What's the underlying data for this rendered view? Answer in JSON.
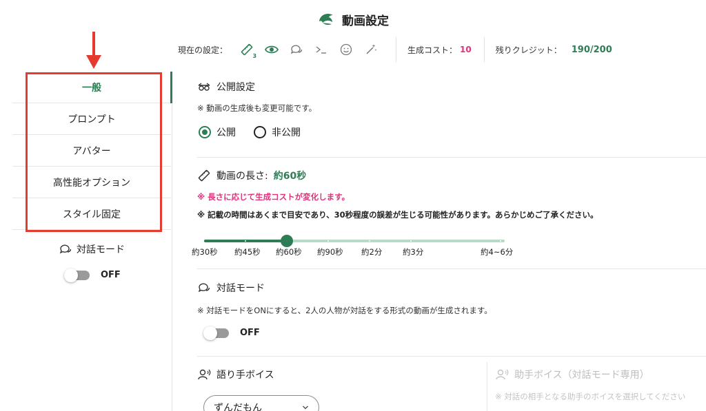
{
  "header": {
    "title": "動画設定",
    "current_label": "現在の設定：",
    "length_badge": "3",
    "cost_label": "生成コスト：",
    "cost_value": "10",
    "credit_label": "残りクレジット：",
    "credit_value": "190/200"
  },
  "sidebar": {
    "items": [
      {
        "label": "一般"
      },
      {
        "label": "プロンプト"
      },
      {
        "label": "アバター"
      },
      {
        "label": "高性能オプション"
      },
      {
        "label": "スタイル固定"
      }
    ],
    "dialog_label": "対話モード",
    "dialog_state": "OFF"
  },
  "main": {
    "visibility": {
      "title": "公開設定",
      "note": "※ 動画の生成後も変更可能です。",
      "options": [
        "公開",
        "非公開"
      ],
      "selected": "公開"
    },
    "length": {
      "title": "動画の長さ:",
      "value": "約60秒",
      "pink_note": "※ 長さに応じて生成コストが変化します。",
      "bold_note": "※ 記載の時間はあくまで目安であり、30秒程度の誤差が生じる可能性があります。あらかじめご了承ください。",
      "levels": [
        "約30秒",
        "約45秒",
        "約60秒",
        "約90秒",
        "約2分",
        "約3分",
        "約4~6分"
      ],
      "selected_index": 2
    },
    "dialog": {
      "title": "対話モード",
      "note": "※ 対話モードをONにすると、2人の人物が対話をする形式の動画が生成されます。",
      "state": "OFF"
    },
    "narrator": {
      "title": "語り手ボイス",
      "value": "ずんだもん"
    },
    "helper": {
      "title": "助手ボイス（対話モード専用）",
      "note": "※ 対話の相手となる助手のボイスを選択してください"
    }
  },
  "colors": {
    "accent_green": "#2e7d55",
    "light_green": "#b7dbc8",
    "pink": "#e0317a",
    "annotation_red": "#e53a2e"
  },
  "icons": [
    "dolphin-logo-icon",
    "ruler-icon",
    "eye-icon",
    "chat-bubbles-icon",
    "terminal-icon",
    "smiley-icon",
    "magic-wand-icon",
    "glasses-icon",
    "person-voice-icon",
    "chevron-down-icon",
    "arrow-down-icon"
  ]
}
